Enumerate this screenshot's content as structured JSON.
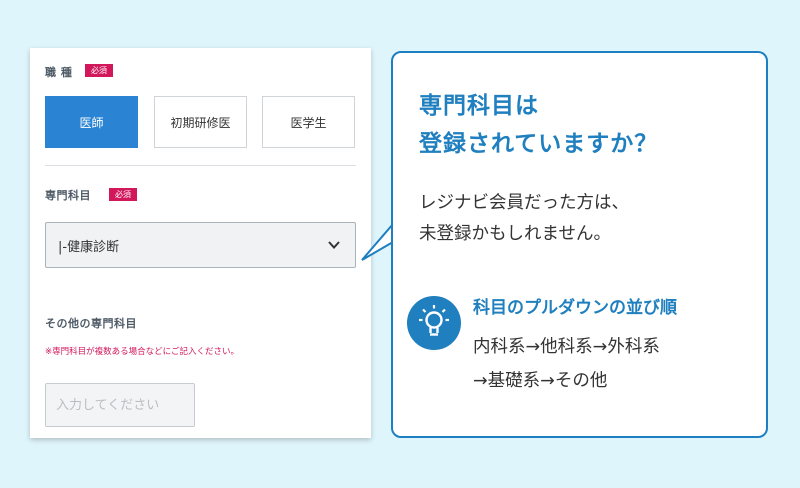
{
  "form": {
    "occupation": {
      "label": "職 種",
      "required_badge": "必須",
      "options": [
        "医師",
        "初期研修医",
        "医学生"
      ],
      "selected": "医師"
    },
    "specialty": {
      "label": "専門科目",
      "required_badge": "必須",
      "select_value": "|-健康診断"
    },
    "other_specialty": {
      "label": "その他の専門科目",
      "note": "※専門科目が複数ある場合などにご記入ください。",
      "placeholder": "入力してください"
    }
  },
  "callout": {
    "title_line1": "専門科目は",
    "title_line2": "登録されていますか？",
    "body_line1": "レジナビ会員だった方は、",
    "body_line2": "未登録かもしれません。",
    "tip": {
      "heading": "科目のプルダウンの並び順",
      "line1": "内科系→他科系→外科系",
      "line2": "→基礎系→その他"
    }
  },
  "colors": {
    "accent": "#1f7fbf",
    "button_active": "#2a84d3",
    "required": "#d2175a",
    "background": "#dff5fc"
  }
}
